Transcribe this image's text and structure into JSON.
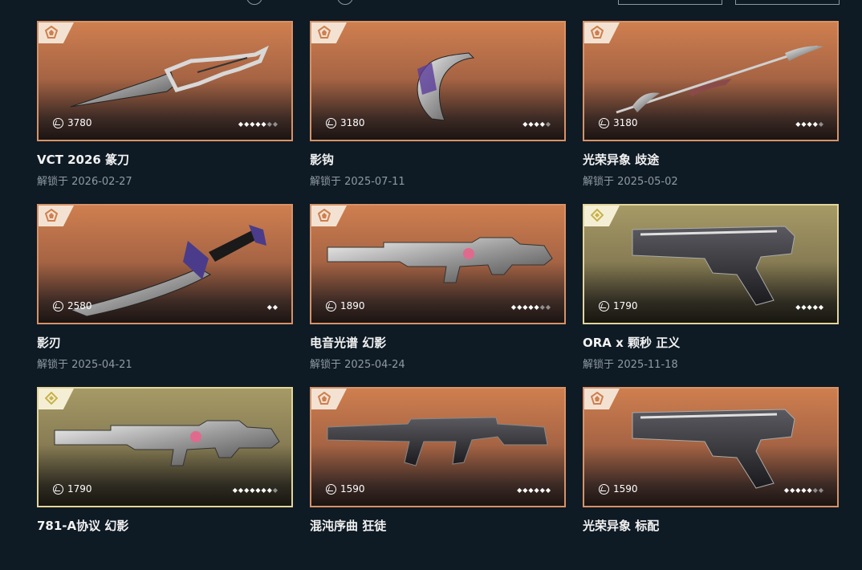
{
  "unlock_prefix": "解锁于",
  "price_icon": "vp-icon",
  "colors": {
    "background": "#0e1a24",
    "orange_border": "#d79267",
    "gold_border": "#e3d59a",
    "subtext": "#8f9aa3"
  },
  "items": [
    {
      "name": "VCT 2026 篆刀",
      "date": "2026-02-27",
      "price": "3780",
      "rating": {
        "filled": 5,
        "total": 7
      },
      "tier": "orange",
      "weapon_icon": "dagger-icon"
    },
    {
      "name": "影钩",
      "date": "2025-07-11",
      "price": "3180",
      "rating": {
        "filled": 4,
        "total": 5
      },
      "tier": "orange",
      "weapon_icon": "karambit-icon"
    },
    {
      "name": "光荣异象 歧途",
      "date": "2025-05-02",
      "price": "3180",
      "rating": {
        "filled": 4,
        "total": 5
      },
      "tier": "orange",
      "weapon_icon": "blade-staff-icon"
    },
    {
      "name": "影刃",
      "date": "2025-04-21",
      "price": "2580",
      "rating": {
        "filled": 2,
        "total": 2
      },
      "tier": "orange",
      "weapon_icon": "sword-icon"
    },
    {
      "name": "电音光谱 幻影",
      "date": "2025-04-24",
      "price": "1890",
      "rating": {
        "filled": 5,
        "total": 7
      },
      "tier": "orange",
      "weapon_icon": "rifle-icon"
    },
    {
      "name": "ORA x 颗秒 正义",
      "date": "2025-11-18",
      "price": "1790",
      "rating": {
        "filled": 5,
        "total": 5
      },
      "tier": "gold",
      "weapon_icon": "pistol-icon"
    },
    {
      "name": "781-A协议 幻影",
      "date": "",
      "price": "1790",
      "rating": {
        "filled": 7,
        "total": 8
      },
      "tier": "gold",
      "weapon_icon": "rifle-icon"
    },
    {
      "name": "混沌序曲 狂徒",
      "date": "",
      "price": "1590",
      "rating": {
        "filled": 6,
        "total": 6
      },
      "tier": "orange",
      "weapon_icon": "assault-rifle-icon"
    },
    {
      "name": "光荣异象 标配",
      "date": "",
      "price": "1590",
      "rating": {
        "filled": 5,
        "total": 7
      },
      "tier": "orange",
      "weapon_icon": "pistol-icon"
    }
  ]
}
